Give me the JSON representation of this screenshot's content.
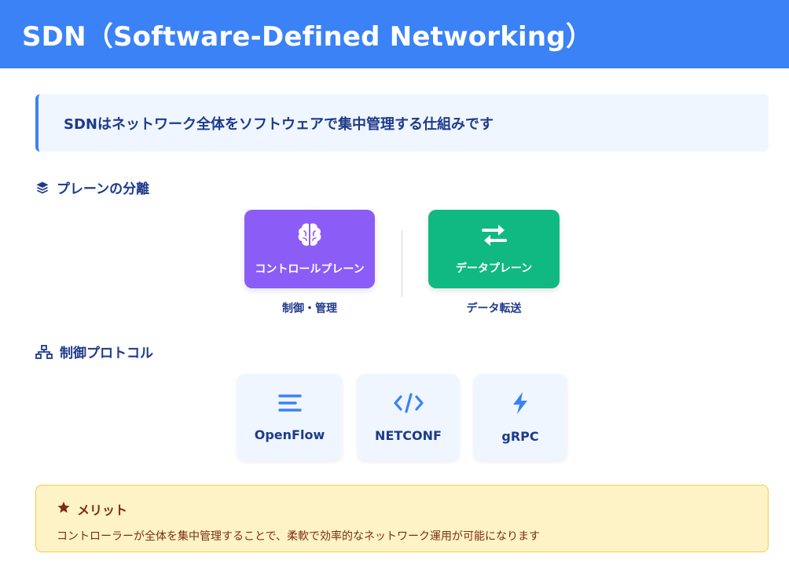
{
  "header": {
    "title": "SDN（Software-Defined Networking）"
  },
  "summary": {
    "text": "SDNはネットワーク全体をソフトウェアで集中管理する仕組みです"
  },
  "sections": {
    "planes": {
      "title": "プレーンの分離",
      "icon": "layers-icon",
      "control": {
        "label": "コントロールプレーン",
        "sub": "制御・管理",
        "icon": "brain-icon",
        "color": "#8b5cf6"
      },
      "data": {
        "label": "データプレーン",
        "sub": "データ転送",
        "icon": "exchange-arrows-icon",
        "color": "#10b981"
      }
    },
    "protocols": {
      "title": "制御プロトコル",
      "icon": "network-tree-icon",
      "items": [
        {
          "label": "OpenFlow",
          "icon": "lines-icon"
        },
        {
          "label": "NETCONF",
          "icon": "code-icon"
        },
        {
          "label": "gRPC",
          "icon": "bolt-icon"
        }
      ]
    }
  },
  "merit": {
    "title": "メリット",
    "icon": "star-icon",
    "text": "コントローラーが全体を集中管理することで、柔軟で効率的なネットワーク運用が可能になります"
  },
  "colors": {
    "primary": "#3b82f6",
    "text": "#1e3a8a",
    "merit_bg": "#fef3c7",
    "merit_text": "#7c2d12"
  }
}
